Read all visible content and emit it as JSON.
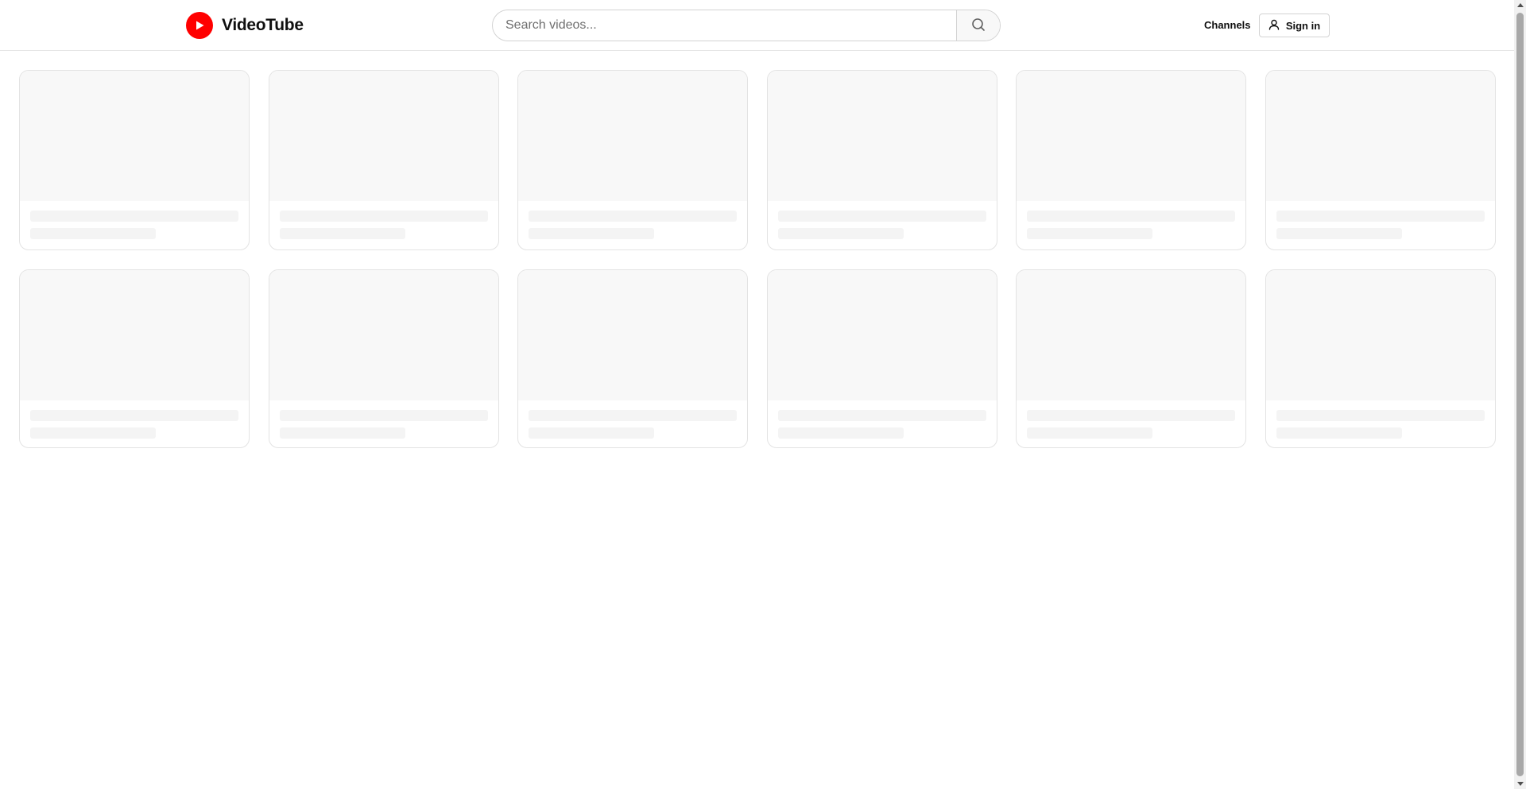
{
  "header": {
    "logo_text": "VideoTube",
    "search": {
      "placeholder": "Search videos...",
      "value": ""
    },
    "nav": {
      "channels_label": "Channels",
      "signin_label": "Sign in"
    }
  },
  "colors": {
    "brand": "#ff0000",
    "skeleton": "#f8f8f8",
    "border": "#e3e3e3"
  },
  "icons": {
    "logo": "play-circle-icon",
    "search": "search-icon",
    "signin": "user-icon"
  },
  "video_grid": {
    "state": "loading",
    "rows": 2,
    "columns": 6
  }
}
